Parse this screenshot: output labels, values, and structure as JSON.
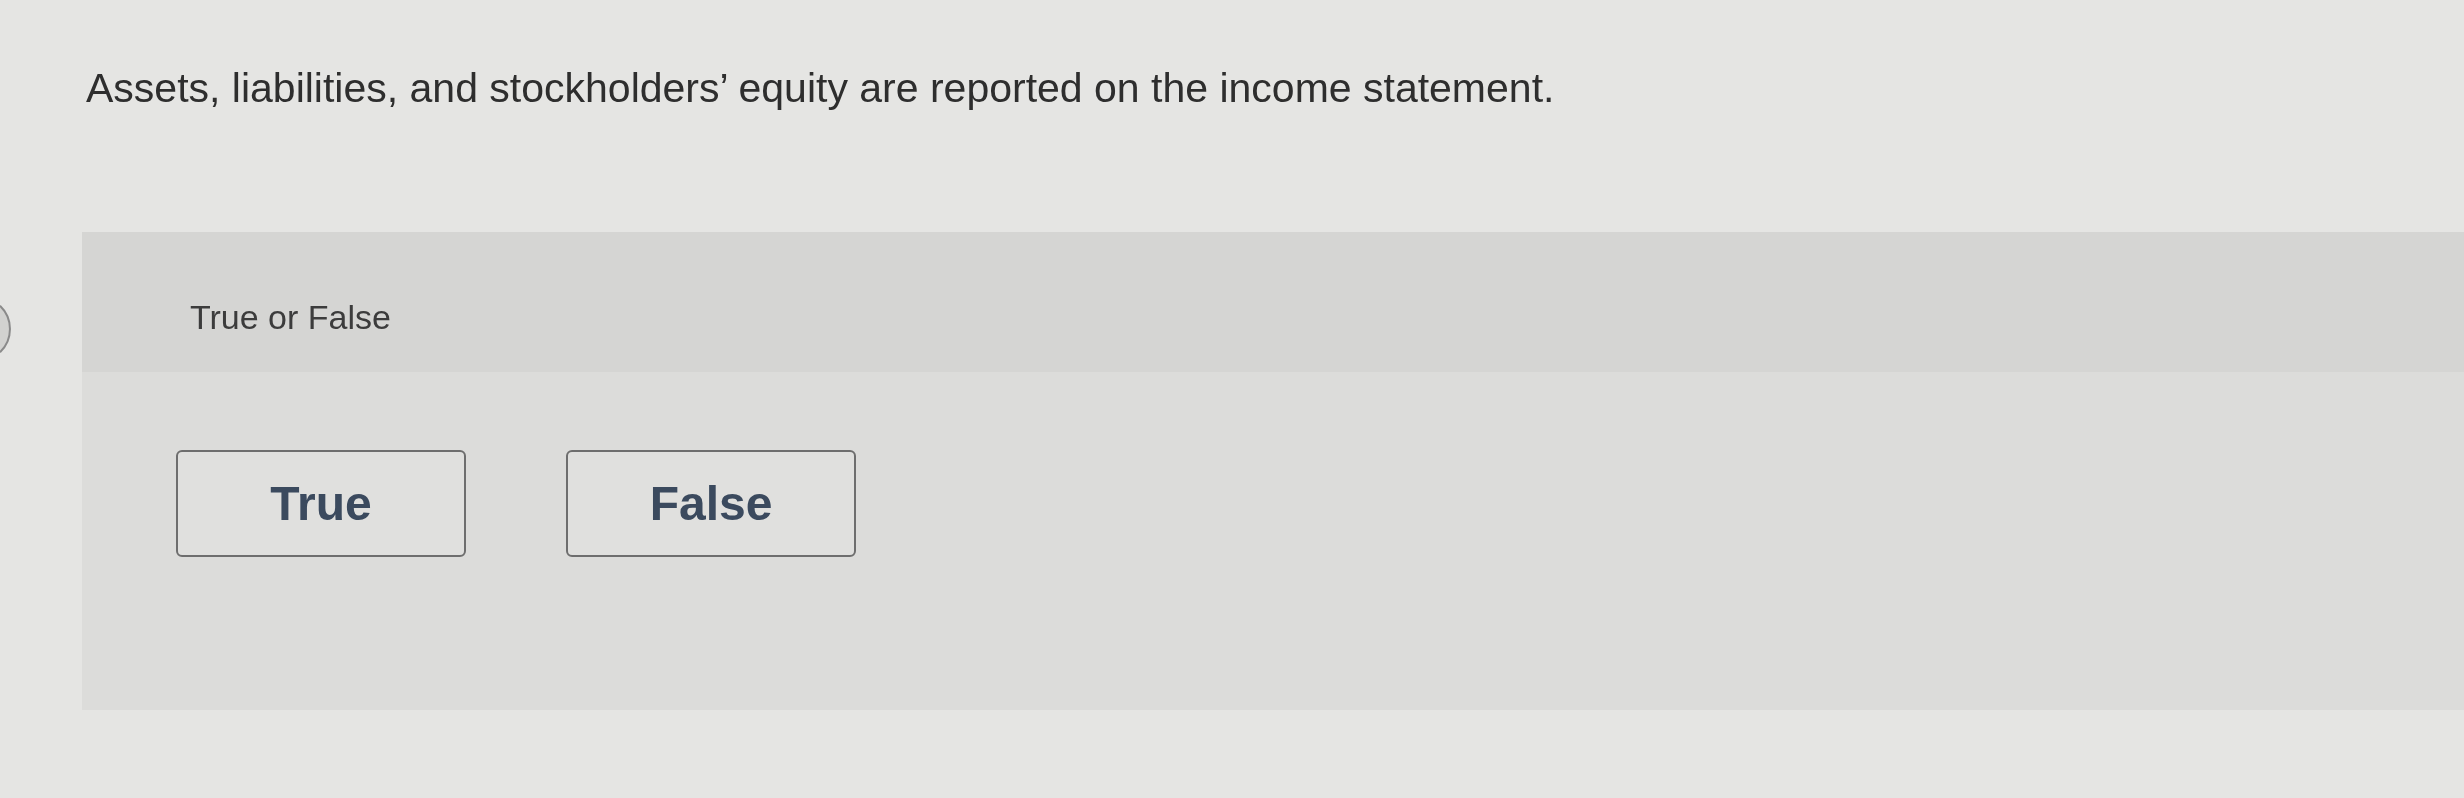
{
  "question": {
    "text": "Assets, liabilities, and stockholders’ equity are reported on the income statement."
  },
  "answer_panel": {
    "prompt": "True or False",
    "options": [
      {
        "label": "True",
        "selected": false
      },
      {
        "label": "False",
        "selected": false
      }
    ]
  }
}
